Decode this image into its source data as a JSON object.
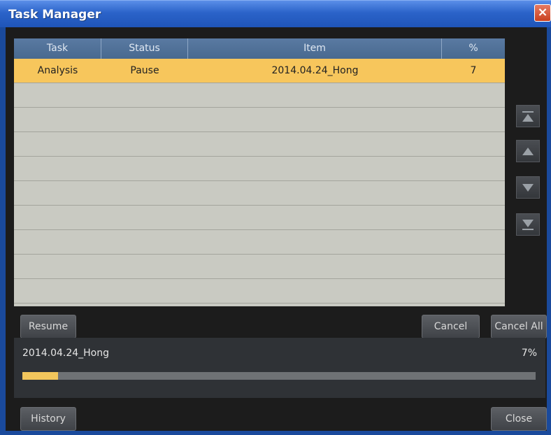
{
  "window": {
    "title": "Task Manager",
    "close_glyph": "×"
  },
  "table": {
    "columns": [
      "Task",
      "Status",
      "Item",
      "%"
    ],
    "rows": [
      {
        "task": "Analysis",
        "status": "Pause",
        "item": "2014.04.24_Hong",
        "percent": "7",
        "selected": true
      }
    ],
    "empty_rows": 9
  },
  "side_controls": [
    {
      "name": "move-top-icon"
    },
    {
      "name": "move-up-icon"
    },
    {
      "name": "move-down-icon"
    },
    {
      "name": "move-bottom-icon"
    }
  ],
  "buttons": {
    "resume": "Resume",
    "cancel": "Cancel",
    "cancel_all": "Cancel All",
    "history": "History",
    "close": "Close"
  },
  "progress": {
    "item": "2014.04.24_Hong",
    "percent_label": "7%",
    "fraction": 0.07
  },
  "colors": {
    "selected_row": "#f7c65c",
    "progress_fill": "#f2c65c",
    "title_bar": "#2b63c9"
  }
}
